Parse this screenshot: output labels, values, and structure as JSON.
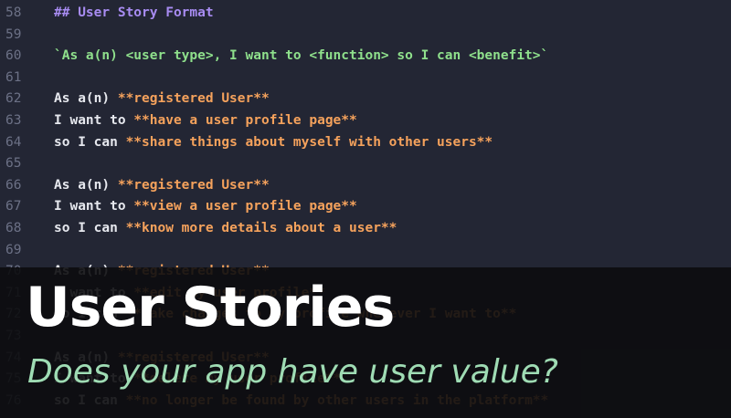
{
  "editor": {
    "lines": [
      {
        "num": "58",
        "segments": [
          {
            "text": "## User Story Format",
            "color": "purple"
          }
        ]
      },
      {
        "num": "59",
        "segments": []
      },
      {
        "num": "60",
        "segments": [
          {
            "text": "`As a(n) <user type>, I want to <function> so I can <benefit>`",
            "color": "green"
          }
        ]
      },
      {
        "num": "61",
        "segments": []
      },
      {
        "num": "62",
        "segments": [
          {
            "text": "As a(n) ",
            "color": "white"
          },
          {
            "text": "**registered User**",
            "color": "orange"
          }
        ]
      },
      {
        "num": "63",
        "segments": [
          {
            "text": "I want to ",
            "color": "white"
          },
          {
            "text": "**have a user profile page**",
            "color": "orange"
          }
        ]
      },
      {
        "num": "64",
        "segments": [
          {
            "text": "so I can ",
            "color": "white"
          },
          {
            "text": "**share things about myself with other users**",
            "color": "orange"
          }
        ]
      },
      {
        "num": "65",
        "segments": []
      },
      {
        "num": "66",
        "segments": [
          {
            "text": "As a(n) ",
            "color": "white"
          },
          {
            "text": "**registered User**",
            "color": "orange"
          }
        ]
      },
      {
        "num": "67",
        "segments": [
          {
            "text": "I want to ",
            "color": "white"
          },
          {
            "text": "**view a user profile page**",
            "color": "orange"
          }
        ]
      },
      {
        "num": "68",
        "segments": [
          {
            "text": "so I can ",
            "color": "white"
          },
          {
            "text": "**know more details about a user**",
            "color": "orange"
          }
        ]
      },
      {
        "num": "69",
        "segments": []
      },
      {
        "num": "70",
        "segments": [
          {
            "text": "As a(n) ",
            "color": "white"
          },
          {
            "text": "**registered User**",
            "color": "orange"
          }
        ]
      },
      {
        "num": "71",
        "segments": [
          {
            "text": "I want to ",
            "color": "white"
          },
          {
            "text": "**edit my user profile**",
            "color": "orange"
          }
        ]
      },
      {
        "num": "72",
        "segments": [
          {
            "text": "so I can ",
            "color": "white"
          },
          {
            "text": "**make changes to my profile whenever I want to**",
            "color": "orange"
          }
        ]
      },
      {
        "num": "73",
        "segments": []
      },
      {
        "num": "74",
        "segments": [
          {
            "text": "As a(n) ",
            "color": "white"
          },
          {
            "text": "**registered User**",
            "color": "orange"
          }
        ]
      },
      {
        "num": "75",
        "segments": [
          {
            "text": "I want to ",
            "color": "white"
          },
          {
            "text": "**delete my user profile**",
            "color": "orange"
          }
        ]
      },
      {
        "num": "76",
        "segments": [
          {
            "text": "so I can ",
            "color": "white"
          },
          {
            "text": "**no longer be found by other users in the platform**",
            "color": "orange"
          }
        ]
      }
    ]
  },
  "banner": {
    "title": "User Stories",
    "subtitle": "Does your app have user value?"
  },
  "colors": {
    "white": "#e6e8ee",
    "purple": "#a88cf2",
    "green": "#8fe08c",
    "orange": "#f5a25c",
    "line_number": "#6c7186",
    "background": "#232634",
    "subtitle": "#9fdcb4"
  }
}
